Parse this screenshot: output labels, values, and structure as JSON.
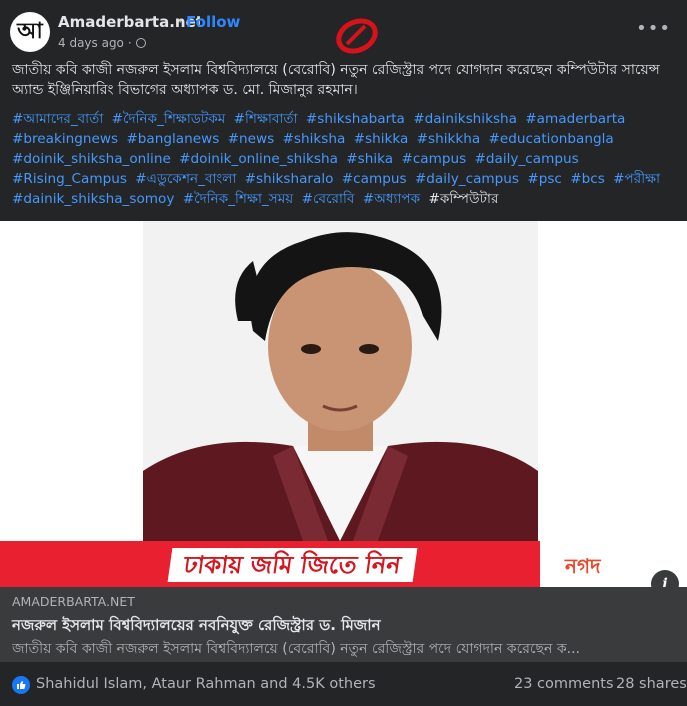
{
  "header": {
    "avatar_text": "আ",
    "page_name": "Amaderbarta.net",
    "separator": "·",
    "follow_label": "Follow",
    "time": "4 days ago",
    "meta_separator": "·",
    "privacy_icon": "globe-icon",
    "more_label": "•••"
  },
  "caption": {
    "text": "জাতীয় কবি কাজী নজরুল ইসলাম বিশ্ববিদ্যালয়ে (বেরোবি) নতুন রেজিস্ট্রার পদে যোগদান করেছেন কম্পিউটার সায়েন্স অ্যান্ড ইঞ্জিনিয়ারিং বিভাগের অধ্যাপক ড. মো. মিজানুর রহমান।"
  },
  "hashtags": [
    "#আমাদের_বার্তা",
    "#দৈনিক_শিক্ষাডটকম",
    "#শিক্ষাবার্তা",
    "#shikshabarta",
    "#dainikshiksha",
    "#amaderbarta",
    "#breakingnews",
    "#banglanews",
    "#news",
    "#shiksha",
    "#shikka",
    "#shikkha",
    "#educationbangla",
    "#doinik_shiksha_online",
    "#doinik_online_shiksha",
    "#shika",
    "#campus",
    "#daily_campus",
    "#Rising_Campus",
    "#এডুকেশন_বাংলা",
    "#shiksharalo",
    "#campus",
    "#daily_campus",
    "#psc",
    "#bcs",
    "#পরীক্ষা",
    "#dainik_shiksha_somoy",
    "#দৈনিক_শিক্ষা_সময়",
    "#বেরোবি",
    "#অধ্যাপক"
  ],
  "hashtag_plain": "#কম্পিউটার",
  "image": {
    "banner_text": "ঢাকায় জমি জিতে নিন",
    "banner_logo": "নগদ",
    "info_label": "i"
  },
  "link": {
    "domain": "AMADERBARTA.NET",
    "title": "নজরুল ইসলাম বিশ্ববিদ্যালয়ের নবনিযুক্ত রেজিস্ট্রার ড. মিজান",
    "description": "জাতীয় কবি কাজী নজরুল ইসলাম বিশ্ববিদ্যালয়ে (বেরোবি) নতুন রেজিস্ট্রার পদে যোগদান করেছেন ক..."
  },
  "reactions": {
    "names": "Shahidul Islam, Ataur Rahman and 4.5K others",
    "comments": "23 comments",
    "shares": "28 shares"
  },
  "colors": {
    "background": "#242526",
    "link_blue": "#2d88ff",
    "banner_red": "#e01e2e",
    "like_blue": "#1877f2"
  }
}
